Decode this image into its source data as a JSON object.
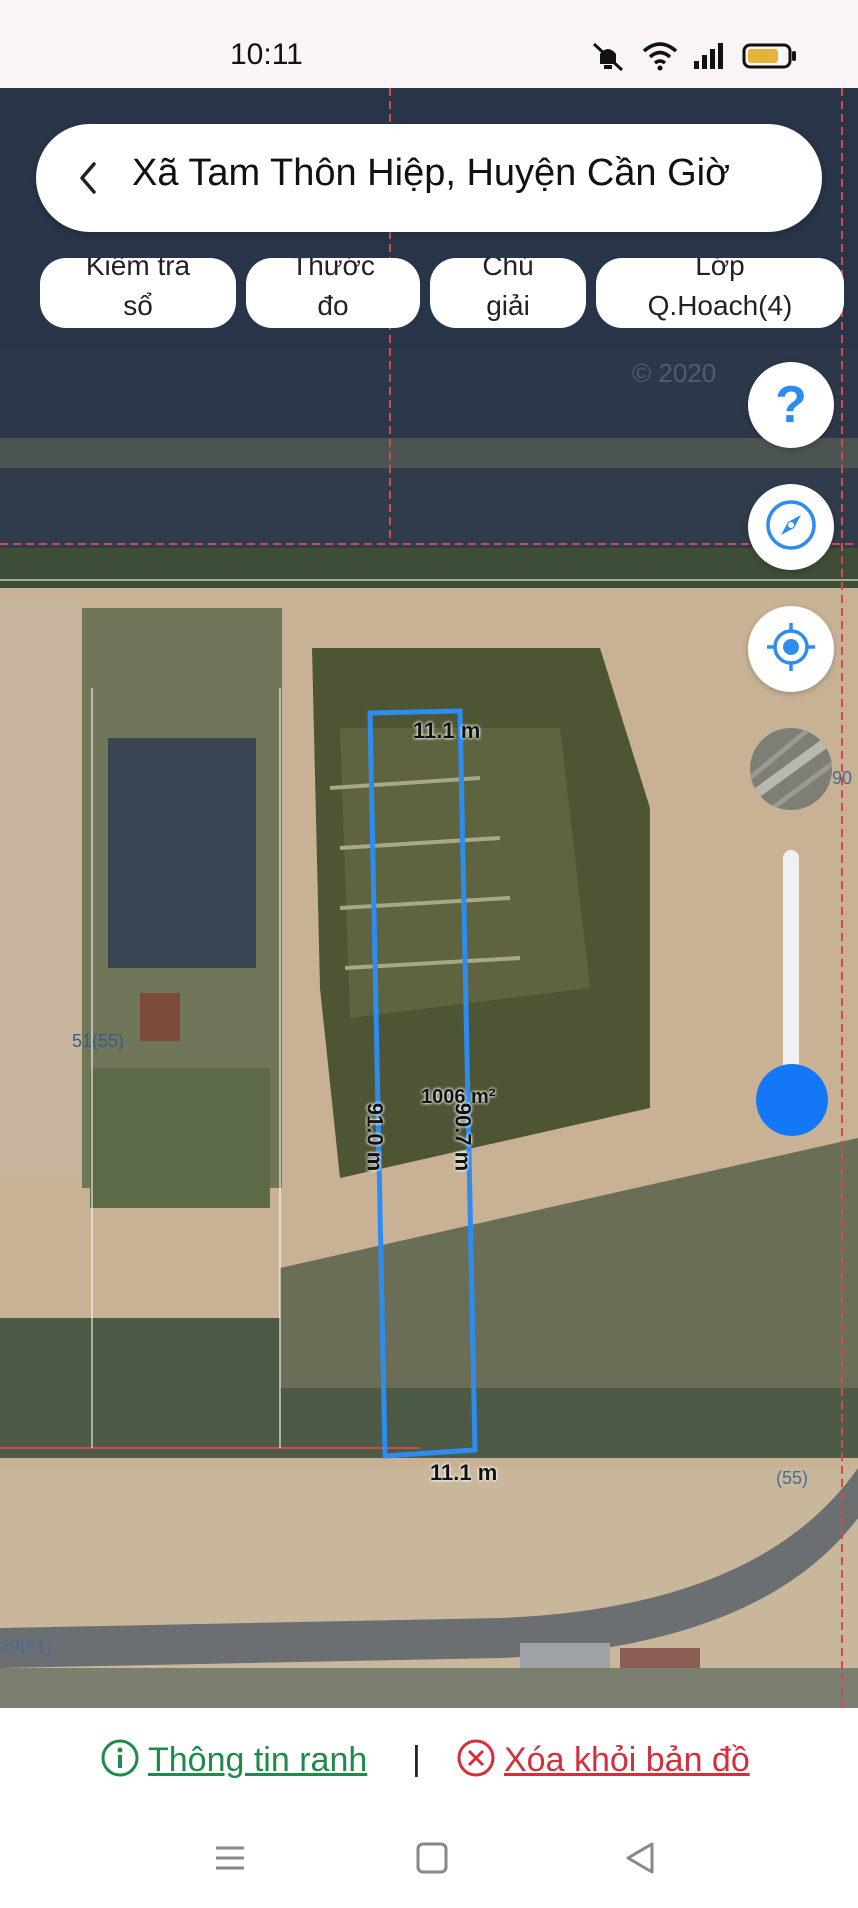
{
  "status": {
    "time": "10:11",
    "battery": "62"
  },
  "header": {
    "title": "Xã Tam Thôn Hiệp, Huyện Cần Giờ"
  },
  "chips": [
    {
      "line1": "Kiểm tra",
      "line2": "sổ"
    },
    {
      "line1": "Thước",
      "line2": "đo"
    },
    {
      "line1": "Chú",
      "line2": "giải"
    },
    {
      "line1": "Lớp",
      "line2": "Q.Hoach(4)"
    }
  ],
  "map": {
    "parcel": {
      "top_edge": "11.1 m",
      "bottom_edge": "11.1 m",
      "left_edge": "91.0 m",
      "right_edge": "90.7 m",
      "area": "1006 m²"
    },
    "labels": {
      "left_lot": "51(55)",
      "bottom_right_lot": "(55)",
      "bottom_left_lot": "39(61)",
      "right_lot": "90",
      "watermark": "© 2020"
    },
    "colors": {
      "parcel_outline": "#2e8cf0",
      "boundary_line": "#d44a4a"
    }
  },
  "controls": {
    "help_icon": "?",
    "compass": "compass-icon",
    "locate": "crosshair-icon"
  },
  "actions": {
    "info_label": "Thông tin ranh",
    "separator": "|",
    "remove_label": "Xóa khỏi bản đồ"
  },
  "colors": {
    "info": "#1f8a4a",
    "remove": "#d3303c",
    "accent": "#1477f8"
  }
}
